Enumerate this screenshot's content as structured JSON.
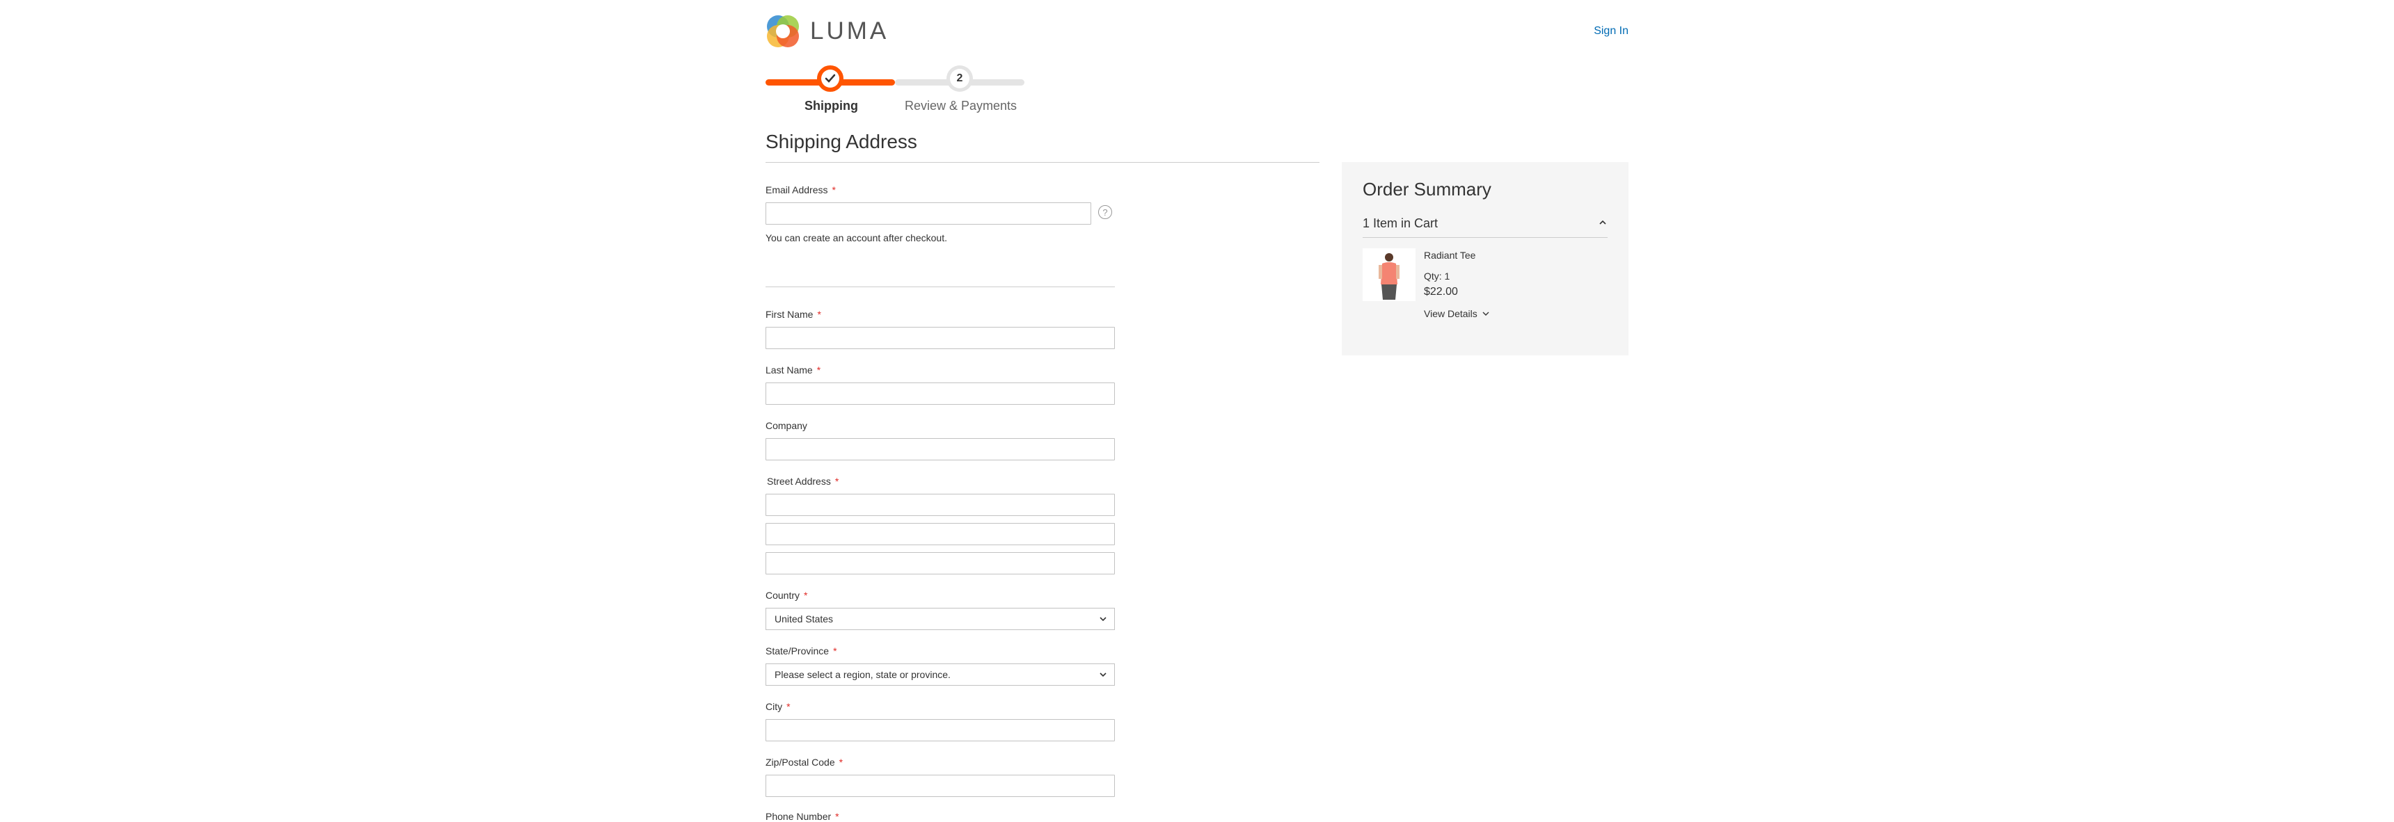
{
  "header": {
    "logo_text": "LUMA",
    "sign_in": "Sign In"
  },
  "progress": {
    "step1_label": "Shipping",
    "step2_number": "2",
    "step2_label": "Review & Payments"
  },
  "shipping": {
    "title": "Shipping Address",
    "email_label": "Email Address",
    "email_value": "",
    "help_symbol": "?",
    "account_note": "You can create an account after checkout.",
    "first_name_label": "First Name",
    "last_name_label": "Last Name",
    "company_label": "Company",
    "street_label": "Street Address",
    "country_label": "Country",
    "country_value": "United States",
    "state_label": "State/Province",
    "state_value": "Please select a region, state or province.",
    "city_label": "City",
    "zip_label": "Zip/Postal Code",
    "phone_label": "Phone Number",
    "required_mark": "*"
  },
  "summary": {
    "title": "Order Summary",
    "items_in_cart": "1 Item in Cart",
    "product_name": "Radiant Tee",
    "product_qty": "Qty: 1",
    "product_price": "$22.00",
    "view_details": "View Details"
  },
  "colors": {
    "accent": "#ff5501",
    "link": "#006bb4",
    "required": "#e02b27",
    "summary_bg": "#f5f5f5"
  }
}
